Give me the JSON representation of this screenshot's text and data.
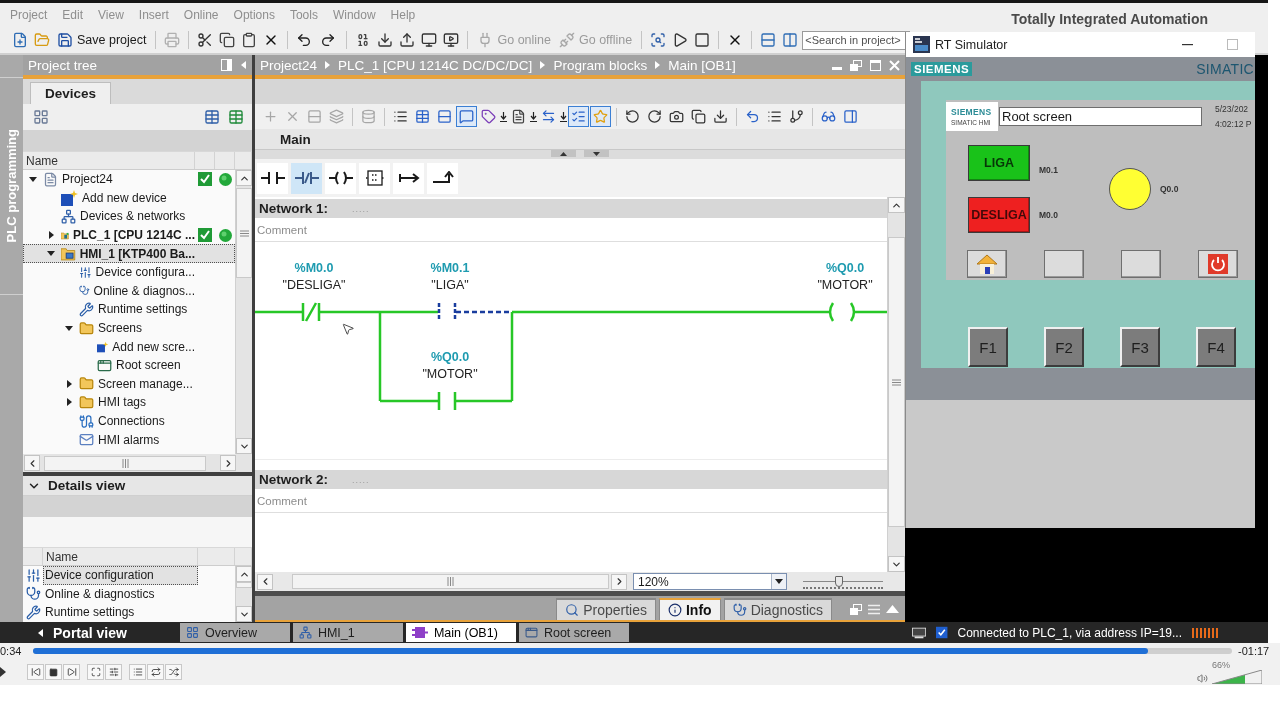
{
  "menu": [
    "Project",
    "Edit",
    "View",
    "Insert",
    "Online",
    "Options",
    "Tools",
    "Window",
    "Help"
  ],
  "product_title": "Totally Integrated Automation",
  "toolbar": {
    "items": [
      {
        "kind": "new",
        "disabled": false
      },
      {
        "kind": "open",
        "disabled": false
      },
      {
        "kind": "save",
        "label": "Save project",
        "disabled": false
      },
      {
        "kind": "print",
        "disabled": true
      },
      {
        "kind": "cut",
        "disabled": false
      },
      {
        "kind": "copy",
        "disabled": false
      },
      {
        "kind": "paste",
        "disabled": false
      },
      {
        "kind": "delete",
        "disabled": false
      },
      {
        "kind": "undo",
        "disabled": false
      },
      {
        "kind": "redo",
        "disabled": false
      },
      {
        "kind": "compile",
        "disabled": false
      },
      {
        "kind": "download",
        "disabled": false
      },
      {
        "kind": "upload",
        "disabled": false
      },
      {
        "kind": "device",
        "disabled": false
      },
      {
        "kind": "simulate",
        "disabled": false
      },
      {
        "kind": "go_online",
        "label": "Go online",
        "disabled": true
      },
      {
        "kind": "go_offline",
        "label": "Go offline",
        "disabled": true
      },
      {
        "kind": "accessible",
        "disabled": false
      },
      {
        "kind": "start_cpu",
        "disabled": false
      },
      {
        "kind": "stop_cpu",
        "disabled": false
      },
      {
        "kind": "cross_ref",
        "disabled": false
      },
      {
        "kind": "split_h",
        "disabled": false
      },
      {
        "kind": "split_v",
        "disabled": false
      }
    ],
    "search": {
      "placeholder": "<Search in project>"
    }
  },
  "side_tab": {
    "label": "PLC programming"
  },
  "project_tree": {
    "title": "Project tree",
    "tabs": [
      {
        "label": "Devices",
        "selected": true
      }
    ],
    "columns": [
      "Name"
    ],
    "items": [
      {
        "label": "Project24",
        "kind": "project",
        "expanded": true,
        "online": true,
        "selected": false,
        "children": [
          {
            "label": "Add new device",
            "kind": "add",
            "online": false,
            "selected": false
          },
          {
            "label": "Devices & networks",
            "kind": "network",
            "online": false,
            "selected": false
          },
          {
            "label": "PLC_1 [CPU 1214C ...",
            "kind": "plc",
            "expanded": false,
            "online": true,
            "selected": false
          },
          {
            "label": "HMI_1 [KTP400 Ba...",
            "kind": "hmi",
            "expanded": true,
            "online": false,
            "selected": true,
            "children": [
              {
                "label": "Device configura...",
                "kind": "config",
                "online": false,
                "selected": false
              },
              {
                "label": "Online & diagnos...",
                "kind": "diagnostics",
                "online": false,
                "selected": false
              },
              {
                "label": "Runtime settings",
                "kind": "settings",
                "online": false,
                "selected": false
              },
              {
                "label": "Screens",
                "kind": "folder",
                "expanded": true,
                "online": false,
                "selected": false,
                "children": [
                  {
                    "label": "Add new scre...",
                    "kind": "add",
                    "online": false,
                    "selected": false
                  },
                  {
                    "label": "Root screen",
                    "kind": "screen",
                    "online": false,
                    "selected": false
                  }
                ]
              },
              {
                "label": "Screen manage...",
                "kind": "folder",
                "expanded": false,
                "online": false,
                "selected": false
              },
              {
                "label": "HMI tags",
                "kind": "folder",
                "expanded": false,
                "online": false,
                "selected": false
              },
              {
                "label": "Connections",
                "kind": "connections",
                "online": false,
                "selected": false
              },
              {
                "label": "HMI alarms",
                "kind": "alarms",
                "online": false,
                "selected": false
              }
            ]
          }
        ]
      }
    ]
  },
  "details_view": {
    "title": "Details view",
    "expanded": true,
    "columns": [
      "Name"
    ],
    "rows": [
      {
        "label": "Device configuration",
        "kind": "config",
        "selected": true
      },
      {
        "label": "Online & diagnostics",
        "kind": "diagnostics",
        "selected": false
      },
      {
        "label": "Runtime settings",
        "kind": "settings",
        "selected": false
      }
    ]
  },
  "editor": {
    "breadcrumb": [
      "Project24",
      "PLC_1 [CPU 1214C DC/DC/DC]",
      "Program blocks",
      "Main [OB1]"
    ],
    "tools": [
      {
        "kind": "insert_network",
        "disabled": true,
        "on": false
      },
      {
        "kind": "delete_network",
        "disabled": true,
        "on": false
      },
      {
        "kind": "insert_row",
        "disabled": true,
        "on": false
      },
      {
        "kind": "append_row",
        "disabled": true,
        "on": false
      },
      {
        "kind": "reset",
        "disabled": true,
        "on": false
      },
      {
        "kind": "lines",
        "disabled": false,
        "on": false
      },
      {
        "kind": "open_all",
        "disabled": false,
        "on": false
      },
      {
        "kind": "close_all",
        "disabled": false,
        "on": false
      },
      {
        "kind": "comments",
        "disabled": false,
        "on": true
      },
      {
        "kind": "operands",
        "disabled": false,
        "on": false
      },
      {
        "kind": "tag_info",
        "disabled": false,
        "on": false
      },
      {
        "kind": "addressing",
        "disabled": false,
        "on": false
      },
      {
        "kind": "favorites",
        "disabled": false,
        "on": true
      },
      {
        "kind": "callouts",
        "disabled": false,
        "on": true
      },
      {
        "kind": "prev_error",
        "disabled": false,
        "on": false
      },
      {
        "kind": "next_error",
        "disabled": false,
        "on": false
      },
      {
        "kind": "snapshot",
        "disabled": false,
        "on": false
      },
      {
        "kind": "copy_snapshot",
        "disabled": false,
        "on": false
      },
      {
        "kind": "load_start",
        "disabled": false,
        "on": false
      },
      {
        "kind": "monitor_back",
        "disabled": false,
        "on": false
      },
      {
        "kind": "watch",
        "disabled": false,
        "on": false
      },
      {
        "kind": "force",
        "disabled": false,
        "on": false
      },
      {
        "kind": "monitor",
        "disabled": false,
        "on": false
      },
      {
        "kind": "panel",
        "disabled": false,
        "on": false
      }
    ],
    "block_title": "Main",
    "lad_palette": [
      {
        "kind": "no_contact",
        "highlighted": false
      },
      {
        "kind": "nc_contact",
        "highlighted": true
      },
      {
        "kind": "coil",
        "highlighted": false
      },
      {
        "kind": "empty_box",
        "highlighted": false
      },
      {
        "kind": "open_branch",
        "highlighted": false
      },
      {
        "kind": "close_branch",
        "highlighted": false
      }
    ],
    "networks": [
      {
        "title": "Network 1:",
        "title_hint": ".....",
        "comment": {
          "placeholder": "Comment"
        },
        "rung": {
          "series": [
            {
              "kind": "nc_contact",
              "address": "%M0.0",
              "tag": "\"DESLIGA\"",
              "powered": true
            }
          ],
          "branches": [
            [
              {
                "kind": "no_contact",
                "address": "%M0.1",
                "tag": "\"LIGA\"",
                "powered": false
              }
            ],
            [
              {
                "kind": "no_contact",
                "address": "%Q0.0",
                "tag": "\"MOTOR\"",
                "powered": true
              }
            ]
          ],
          "output": {
            "kind": "coil",
            "address": "%Q0.0",
            "tag": "\"MOTOR\"",
            "powered": true
          }
        }
      },
      {
        "title": "Network 2:",
        "title_hint": ".....",
        "comment": {
          "placeholder": "Comment"
        }
      }
    ],
    "zoom": {
      "value": "120%",
      "level": 0.45
    }
  },
  "inspector_tabs": [
    {
      "label": "Properties",
      "kind": "properties",
      "selected": false
    },
    {
      "label": "Info",
      "kind": "info",
      "selected": true
    },
    {
      "label": "Diagnostics",
      "kind": "diagnostics",
      "selected": false
    }
  ],
  "portal_bar": {
    "portal_view": "Portal view",
    "tabs": [
      {
        "label": "Overview",
        "kind": "overview",
        "selected": false
      },
      {
        "label": "HMI_1",
        "kind": "device",
        "selected": false
      },
      {
        "label": "Main (OB1)",
        "kind": "block",
        "selected": true
      },
      {
        "label": "Root screen",
        "kind": "screen",
        "selected": false
      }
    ],
    "status": "Connected to PLC_1, via address IP=19..."
  },
  "rt_simulator": {
    "title": "RT Simulator",
    "brand": "SIEMENS",
    "model": "SIMATIC",
    "hmi": {
      "logo": {
        "brand": "SIEMENS",
        "product": "SIMATIC HMI"
      },
      "screen_title": "Root screen",
      "date": "5/23/202",
      "time": "4:02:12 P",
      "buttons": [
        {
          "label": "LIGA",
          "color": "#19c219",
          "tag": "M0.1"
        },
        {
          "label": "DESLIGA",
          "color": "#ee2020",
          "tag": "M0.0"
        }
      ],
      "lamp": {
        "on": true,
        "tag": "Q0.0"
      },
      "nav_buttons": [
        {
          "kind": "home"
        },
        {
          "kind": "blank"
        },
        {
          "kind": "blank"
        },
        {
          "kind": "power"
        }
      ]
    },
    "function_keys": [
      "F1",
      "F2",
      "F3",
      "F4"
    ]
  },
  "video_player": {
    "elapsed": "0:34",
    "remaining": "-01:17",
    "progress": {
      "level": 0.93
    },
    "volume": {
      "level": 0.66,
      "reading": "66%"
    }
  }
}
